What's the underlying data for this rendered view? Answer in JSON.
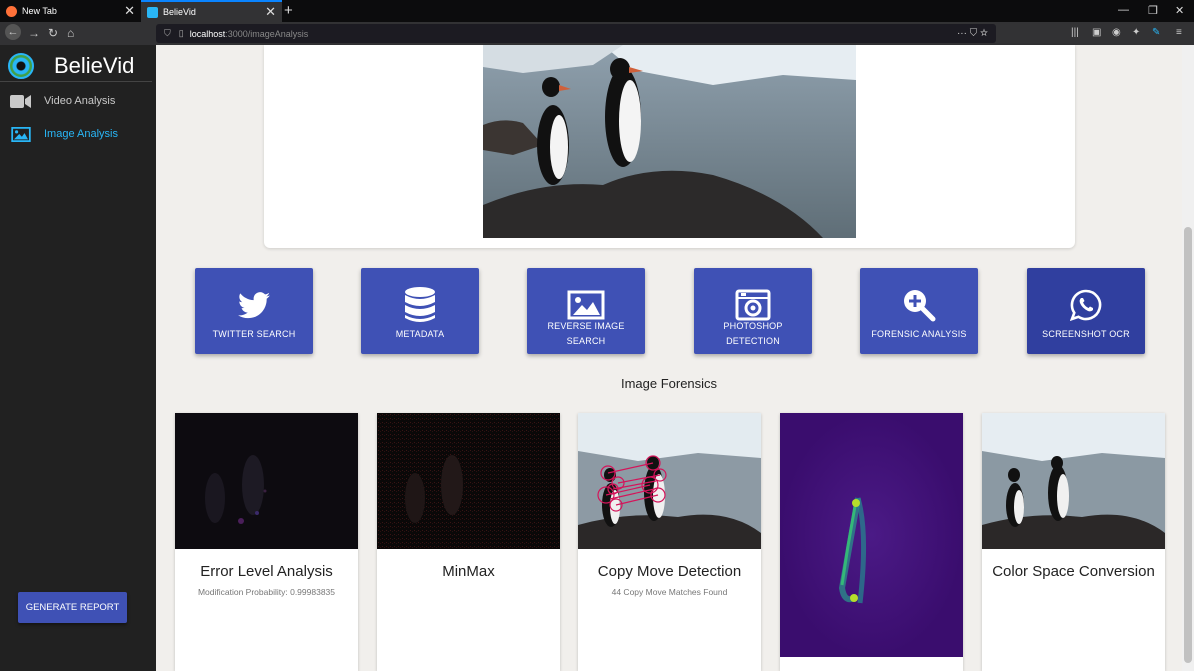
{
  "browser": {
    "tabs": [
      {
        "label": "New Tab",
        "active": false
      },
      {
        "label": "BelieVid",
        "active": true
      }
    ],
    "url_host": "localhost",
    "url_path": ":3000/imageAnalysis"
  },
  "sidebar": {
    "brand": "BelieVid",
    "items": [
      {
        "label": "Video Analysis",
        "icon": "video-camera-icon",
        "active": false
      },
      {
        "label": "Image Analysis",
        "icon": "image-icon",
        "active": true
      }
    ],
    "generate_report": "GENERATE REPORT"
  },
  "actions": [
    {
      "label": "TWITTER SEARCH",
      "icon": "twitter-icon"
    },
    {
      "label": "METADATA",
      "icon": "database-icon"
    },
    {
      "label": "REVERSE IMAGE SEARCH",
      "icon": "image-icon"
    },
    {
      "label": "PHOTOSHOP DETECTION",
      "icon": "camera-icon"
    },
    {
      "label": "FORENSIC ANALYSIS",
      "icon": "zoom-in-icon"
    },
    {
      "label": "SCREENSHOT OCR",
      "icon": "whatsapp-icon"
    }
  ],
  "forensics": {
    "title": "Image Forensics",
    "cards": [
      {
        "title": "Error Level Analysis",
        "subtitle": "Modification Probability: 0.99983835"
      },
      {
        "title": "MinMax",
        "subtitle": ""
      },
      {
        "title": "Copy Move Detection",
        "subtitle": "44 Copy Move Matches Found"
      },
      {
        "title": "",
        "subtitle": ""
      },
      {
        "title": "Color Space Conversion",
        "subtitle": ""
      }
    ]
  },
  "colors": {
    "primary": "#3f51b5",
    "primary_dark": "#303f9f",
    "accent": "#29b6f6",
    "sidebar_bg": "#212121"
  }
}
